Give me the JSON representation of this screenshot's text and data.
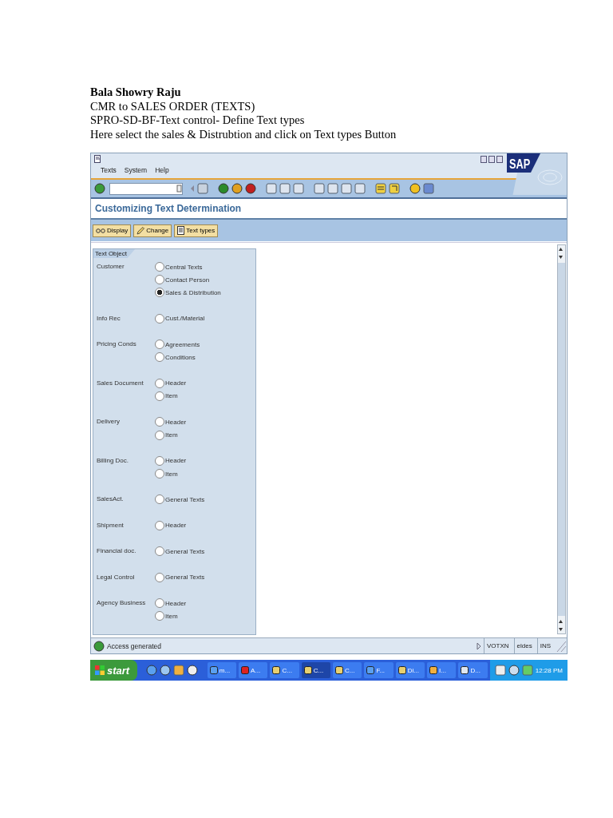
{
  "document": {
    "author": "Bala Showry  Raju",
    "lines": [
      "CMR to SALES ORDER (TEXTS)",
      "SPRO-SD-BF-Text control- Define Text types",
      "Here select the sales & Distrubtion and click on Text types Button"
    ]
  },
  "sap": {
    "menu": [
      "Texts",
      "System",
      "Help"
    ],
    "logo": "SAP",
    "title": "Customizing Text Determination",
    "app_buttons": [
      {
        "kind": "display",
        "label": "Display"
      },
      {
        "kind": "change",
        "label": "Change"
      },
      {
        "kind": "texttypes",
        "label": "Text types"
      }
    ],
    "legend": "Text Object",
    "groups": [
      {
        "label": "Customer",
        "options": [
          {
            "label": "Central Texts",
            "selected": false
          },
          {
            "label": "Contact Person",
            "selected": false
          },
          {
            "label": "Sales & Distribution",
            "selected": true
          }
        ]
      },
      {
        "label": "Info Rec",
        "options": [
          {
            "label": "Cust./Material",
            "selected": false
          }
        ]
      },
      {
        "label": "Pricing Conds",
        "options": [
          {
            "label": "Agreements",
            "selected": false
          },
          {
            "label": "Conditions",
            "selected": false
          }
        ]
      },
      {
        "label": "Sales Document",
        "options": [
          {
            "label": "Header",
            "selected": false
          },
          {
            "label": "Item",
            "selected": false
          }
        ]
      },
      {
        "label": "Delivery",
        "options": [
          {
            "label": "Header",
            "selected": false
          },
          {
            "label": "Item",
            "selected": false
          }
        ]
      },
      {
        "label": "Billing Doc.",
        "options": [
          {
            "label": "Header",
            "selected": false
          },
          {
            "label": "Item",
            "selected": false
          }
        ]
      },
      {
        "label": "SalesAct.",
        "options": [
          {
            "label": "General Texts",
            "selected": false
          }
        ]
      },
      {
        "label": "Shipment",
        "options": [
          {
            "label": "Header",
            "selected": false
          }
        ]
      },
      {
        "label": "Financial doc.",
        "options": [
          {
            "label": "General Texts",
            "selected": false
          }
        ]
      },
      {
        "label": "Legal Control",
        "options": [
          {
            "label": "General Texts",
            "selected": false
          }
        ]
      },
      {
        "label": "Agency Business",
        "options": [
          {
            "label": "Header",
            "selected": false
          },
          {
            "label": "Item",
            "selected": false
          }
        ]
      }
    ],
    "status": {
      "message": "Access generated",
      "fields": [
        "VOTXN",
        "eldes",
        "INS"
      ]
    }
  },
  "taskbar": {
    "start": "start",
    "buttons": [
      {
        "label": "m...",
        "kind": "browser",
        "selected": false
      },
      {
        "label": "A...",
        "kind": "pdf",
        "selected": false
      },
      {
        "label": "C...",
        "kind": "sap",
        "selected": false
      },
      {
        "label": "C...",
        "kind": "sap",
        "selected": true
      },
      {
        "label": "C...",
        "kind": "sap",
        "selected": false
      },
      {
        "label": "F...",
        "kind": "browser",
        "selected": false
      },
      {
        "label": "Di...",
        "kind": "sap",
        "selected": false
      },
      {
        "label": "I...",
        "kind": "mail",
        "selected": false
      },
      {
        "label": "D...",
        "kind": "doc",
        "selected": false
      }
    ],
    "clock": "12:28 PM"
  }
}
